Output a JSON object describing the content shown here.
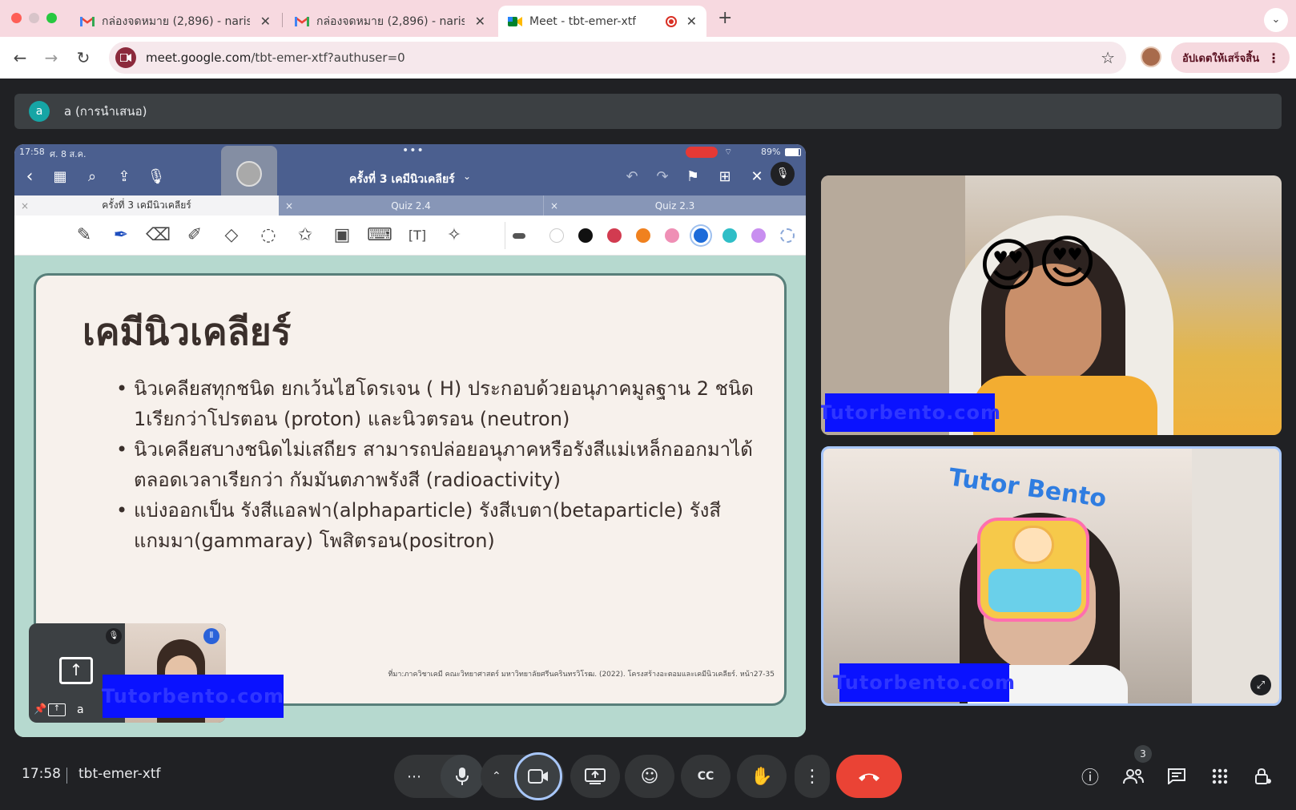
{
  "browser": {
    "tabs": [
      {
        "title": "กล่องจดหมาย (2,896) - narissa",
        "active": false
      },
      {
        "title": "กล่องจดหมาย (2,896) - narissa",
        "active": false
      },
      {
        "title": "Meet - tbt-emer-xtf",
        "active": true
      }
    ],
    "new_tab": "+",
    "address_domain": "meet.google.com",
    "address_path": "/tbt-emer-xtf?authuser=0",
    "update_label": "อัปเดตให้เสร็จสิ้น"
  },
  "meet": {
    "presenter_initial": "a",
    "presenter_label": "a (การนำเสนอ)",
    "time": "17:58",
    "meeting_code": "tbt-emer-xtf",
    "participants_count": "3",
    "self_name": "a"
  },
  "ipad": {
    "status_time": "17:58",
    "status_date": "ศ. 8 ส.ค.",
    "battery": "89%",
    "doc_title": "ครั้งที่ 3 เคมีนิวเคลียร์",
    "tabs": [
      "ครั้งที่ 3 เคมีนิวเคลียร์",
      "Quiz 2.4",
      "Quiz 2.3"
    ]
  },
  "slide": {
    "title": "เคมีนิวเคลียร์",
    "bullets": [
      "นิวเคลียสทุกชนิด ยกเว้นไฮโดรเจน ( H) ประกอบด้วยอนุภาคมูลฐาน 2 ชนิด 1เรียกว่าโปรตอน (proton) และนิวตรอน (neutron)",
      "นิวเคลียสบางชนิดไม่เสถียร สามารถปล่อยอนุภาคหรือรังสีแม่เหล็กออกมาได้ตลอดเวลาเรียกว่า กัมมันตภาพรังสี (radioactivity)",
      "แบ่งออกเป็น รังสีแอลฟา(alphaparticle)  รังสีเบตา(betaparticle) รังสีแกมมา(gammaray)  โพสิตรอน(positron)"
    ],
    "footer": "ที่มา:ภาควิชาเคมี คณะวิทยาศาสตร์ มหาวิทยาลัยศรีนครินทรวิโรฒ. (2022). โครงสร้างอะตอมและเคมีนิวเคลียร์. หน้า27-35"
  },
  "watermark": "Tutorbento.com",
  "icons": [
    "gmail-icon",
    "meet-icon",
    "back-icon",
    "forward-icon",
    "reload-icon",
    "star-icon",
    "mic-icon",
    "camera-icon",
    "present-icon",
    "emoji-icon",
    "captions-icon",
    "hand-icon",
    "more-icon",
    "end-call-icon",
    "info-icon",
    "people-icon",
    "chat-icon",
    "apps-icon",
    "host-controls-icon"
  ],
  "colors": {
    "tabbar": "#f7d9e0",
    "meet_bg": "#202124",
    "end_call": "#ea4335",
    "ipad_header": "#4b5f8f",
    "slide_border": "#587f7a",
    "watermark": "#0a12ff"
  }
}
